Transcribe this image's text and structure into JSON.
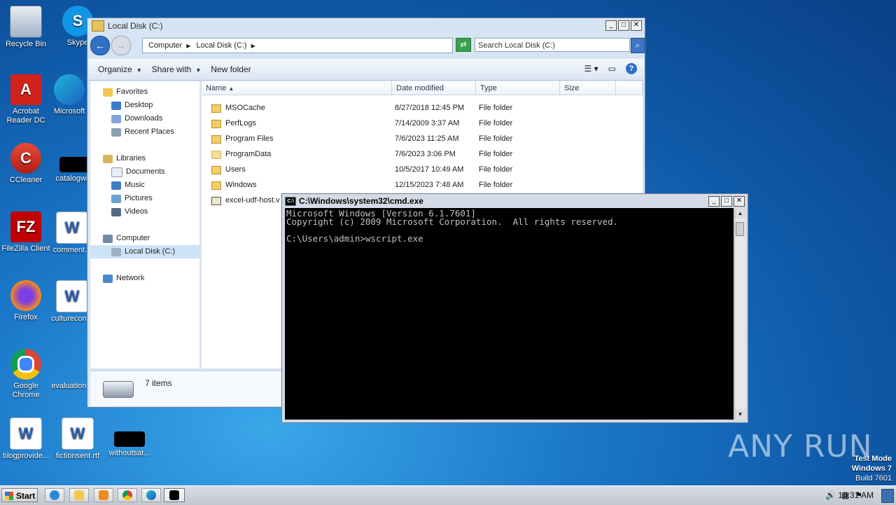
{
  "desktop": {
    "icons": [
      {
        "label": "Recycle Bin"
      },
      {
        "label": "Skype"
      },
      {
        "label": "Acrobat Reader DC"
      },
      {
        "label": "Microsoft"
      },
      {
        "label": "CCleaner"
      },
      {
        "label": "catalogwi..."
      },
      {
        "label": "FileZilla Client"
      },
      {
        "label": "comment..."
      },
      {
        "label": "Firefox"
      },
      {
        "label": "culturecon..."
      },
      {
        "label": "Google Chrome"
      },
      {
        "label": "evaluation..."
      },
      {
        "label": "blogprovide..."
      },
      {
        "label": "fictionsent.rtf"
      },
      {
        "label": "withoutsat..."
      }
    ],
    "watermark": "ANY RUN",
    "test_mode": {
      "line1": "Test Mode",
      "line2": "Windows 7",
      "line3": "Build 7601"
    }
  },
  "explorer": {
    "title": "Local Disk (C:)",
    "breadcrumb": [
      "Computer",
      "Local Disk (C:)"
    ],
    "search_placeholder": "Search Local Disk (C:)",
    "toolbar": {
      "organize": "Organize",
      "share_with": "Share with",
      "new_folder": "New folder"
    },
    "nav": {
      "favorites": "Favorites",
      "desktop": "Desktop",
      "downloads": "Downloads",
      "recent": "Recent Places",
      "libraries": "Libraries",
      "documents": "Documents",
      "music": "Music",
      "pictures": "Pictures",
      "videos": "Videos",
      "computer": "Computer",
      "local_disk": "Local Disk (C:)",
      "network": "Network"
    },
    "columns": {
      "name": "Name",
      "date": "Date modified",
      "type": "Type",
      "size": "Size"
    },
    "files": [
      {
        "name": "MSOCache",
        "date": "8/27/2018 12:45 PM",
        "type": "File folder"
      },
      {
        "name": "PerfLogs",
        "date": "7/14/2009 3:37 AM",
        "type": "File folder"
      },
      {
        "name": "Program Files",
        "date": "7/6/2023 11:25 AM",
        "type": "File folder"
      },
      {
        "name": "ProgramData",
        "date": "7/6/2023 3:06 PM",
        "type": "File folder"
      },
      {
        "name": "Users",
        "date": "10/5/2017 10:49 AM",
        "type": "File folder"
      },
      {
        "name": "Windows",
        "date": "12/15/2023 7:48 AM",
        "type": "File folder"
      },
      {
        "name": "excel-udf-host.v",
        "date": "",
        "type": ""
      }
    ],
    "status": "7 items"
  },
  "cmd": {
    "title": "C:\\Windows\\system32\\cmd.exe",
    "lines": [
      "Microsoft Windows [Version 6.1.7601]",
      "Copyright (c) 2009 Microsoft Corporation.  All rights reserved.",
      "",
      "C:\\Users\\admin>wscript.exe"
    ]
  },
  "taskbar": {
    "start": "Start",
    "clock": "10:31 AM"
  }
}
